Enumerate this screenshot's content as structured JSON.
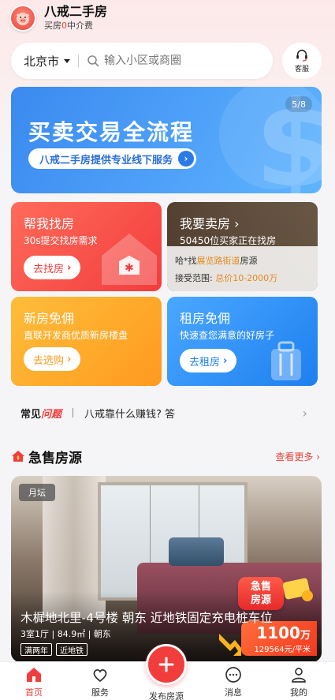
{
  "header": {
    "brand_title": "八戒二手房",
    "brand_sub_prefix": "买房",
    "brand_sub_zero": "0",
    "brand_sub_suffix": "中介费"
  },
  "search": {
    "city": "北京市",
    "placeholder": "输入小区或商圈"
  },
  "service": {
    "label": "客服"
  },
  "banner": {
    "title": "买卖交易全流程",
    "subtitle": "八戒二手房提供专业线下服务",
    "counter": "5/8"
  },
  "cards": {
    "find": {
      "title": "帮我找房",
      "sub": "30s提交找房需求",
      "button": "去找房"
    },
    "sell": {
      "title": "我要卖房",
      "sub": "50450位买家正在找房",
      "line1_prefix": "哈*找",
      "line1_highlight": "展览路街道",
      "line1_suffix": "房源",
      "line2_prefix": "接受范围: ",
      "line2_highlight": "总价10-2000万"
    },
    "new": {
      "title": "新房免佣",
      "sub": "直联开发商优质新房楼盘",
      "button": "去选购"
    },
    "rent": {
      "title": "租房免佣",
      "sub": "快速查您满意的好房子",
      "button": "去租房"
    }
  },
  "faq": {
    "tag_prefix": "常见",
    "tag_highlight": "问题",
    "text": "八戒靠什么赚钱? 答"
  },
  "section": {
    "title": "急售房源",
    "more": "查看更多"
  },
  "listing": {
    "month_tag": "月坛",
    "title": "木樨地北里-4号楼 朝东 近地铁固定充电桩车位",
    "meta": "3室1厅 | 84.9㎡ | 朝东",
    "badges": [
      "满两年",
      "近地铁"
    ],
    "urgent_line1": "急售",
    "urgent_line2": "房源",
    "price_value": "1100",
    "price_unit": "万",
    "unit_price": "129564元/平米"
  },
  "tabbar": {
    "home": "首页",
    "service": "服务",
    "publish": "发布房源",
    "message": "消息",
    "mine": "我的"
  },
  "colors": {
    "accent_red": "#f23d3d",
    "banner_blue": "#3a8af0",
    "highlight_orange": "#e38a1f"
  }
}
